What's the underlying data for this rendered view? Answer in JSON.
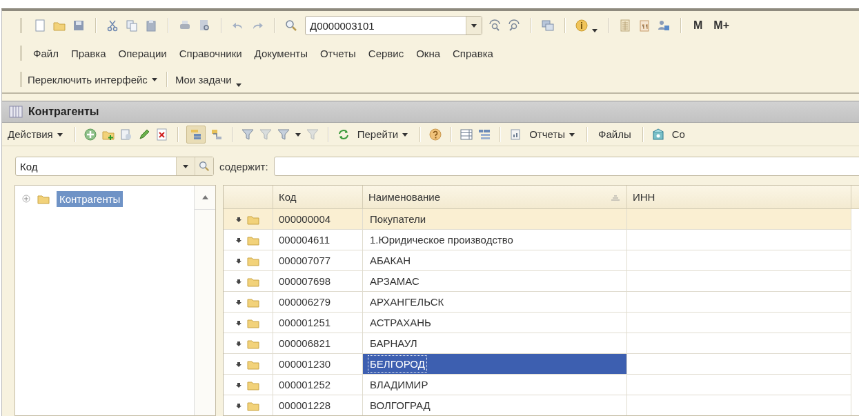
{
  "toolbar": {
    "search_value": "Д0000003101",
    "buttons": [
      {
        "label": "M"
      },
      {
        "label": "M+"
      }
    ]
  },
  "menu": [
    {
      "label": "Файл"
    },
    {
      "label": "Правка"
    },
    {
      "label": "Операции"
    },
    {
      "label": "Справочники"
    },
    {
      "label": "Документы"
    },
    {
      "label": "Отчеты"
    },
    {
      "label": "Сервис"
    },
    {
      "label": "Окна"
    },
    {
      "label": "Справка"
    }
  ],
  "panel": {
    "buttons": [
      {
        "label": "Переключить интерфейс",
        "kind": "dropdown"
      },
      {
        "label": "Мои задачи",
        "kind": "chevron"
      }
    ]
  },
  "window": {
    "title": "Контрагенты"
  },
  "actions_toolbar": {
    "hierarchy_on": true,
    "buttons": [
      {
        "label": "Действия",
        "kind": "dropdown"
      },
      {
        "label": "Перейти",
        "kind": "dropdown"
      },
      {
        "label": "Отчеты",
        "kind": "dropdown"
      },
      {
        "label": "Файлы",
        "kind": "plain"
      },
      {
        "label": "Со",
        "kind": "plain"
      }
    ]
  },
  "filter": {
    "field": "Код",
    "label": "содержит:"
  },
  "tree": [
    {
      "label": "Контрагенты",
      "selected": true,
      "expanded": false
    }
  ],
  "table": {
    "columns": [
      {
        "label": "Код",
        "sorted": false
      },
      {
        "label": "Наименование",
        "sorted": true
      },
      {
        "label": "ИНН",
        "sorted": false
      }
    ],
    "rows": [
      {
        "code": "000000004",
        "name": "Покупатели",
        "current": true,
        "selected": false
      },
      {
        "code": "000004611",
        "name": "1.Юридическое производство",
        "current": false,
        "selected": false
      },
      {
        "code": "000007077",
        "name": "АБАКАН",
        "current": false,
        "selected": false
      },
      {
        "code": "000007698",
        "name": "АРЗАМАС",
        "current": false,
        "selected": false
      },
      {
        "code": "000006279",
        "name": "АРХАНГЕЛЬСК",
        "current": false,
        "selected": false
      },
      {
        "code": "000001251",
        "name": "АСТРАХАНЬ",
        "current": false,
        "selected": false
      },
      {
        "code": "000006821",
        "name": "БАРНАУЛ",
        "current": false,
        "selected": false
      },
      {
        "code": "000001230",
        "name": "БЕЛГОРОД",
        "current": false,
        "selected": true
      },
      {
        "code": "000001252",
        "name": "ВЛАДИМИР",
        "current": false,
        "selected": false
      },
      {
        "code": "000001228",
        "name": "ВОЛГОГРАД",
        "current": false,
        "selected": false
      }
    ]
  }
}
